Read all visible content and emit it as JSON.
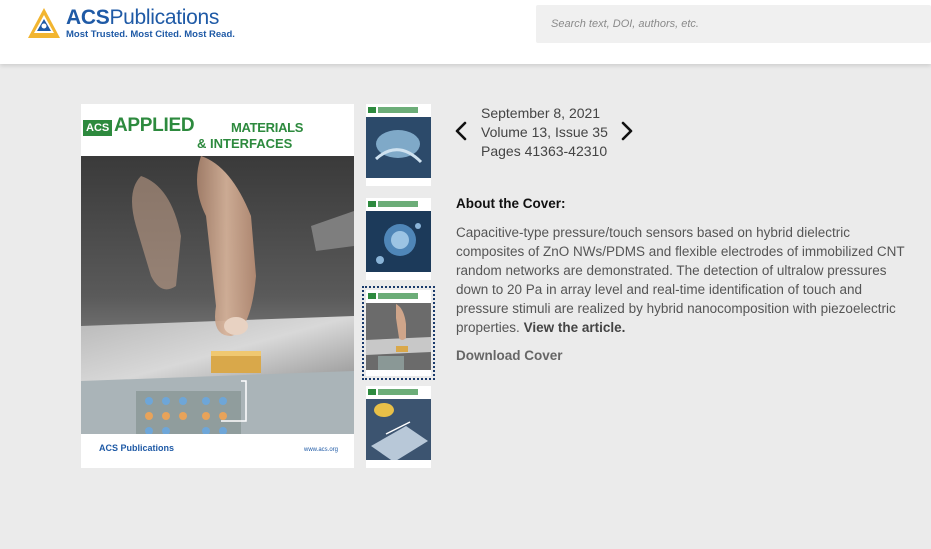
{
  "header": {
    "logo_name_bold": "ACS",
    "logo_name_rest": "Publications",
    "logo_tagline": "Most Trusted. Most Cited. Most Read.",
    "search_placeholder": "Search text, DOI, authors, etc."
  },
  "cover": {
    "badge": "ACS",
    "title_line1": "APPLIED",
    "title_line1b": "MATERIALS",
    "title_line2": "& INTERFACES",
    "footer_logo": "ACS Publications",
    "footer_url": "www.acs.org"
  },
  "issue": {
    "date": "September 8, 2021",
    "volume": "Volume 13, Issue 35",
    "pages": "Pages 41363-42310",
    "prev_icon": "chevron-left-icon",
    "next_icon": "chevron-right-icon"
  },
  "about": {
    "title": "About the Cover:",
    "text": "Capacitive-type pressure/touch sensors based on hybrid dielectric composites of ZnO NWs/PDMS and flexible electrodes of immobilized CNT random networks are demonstrated. The detection of ultralow pressures down to 20 Pa in array level and real-time identification of touch and pressure stimuli are realized by hybrid nanocomposition with piezoelectric properties.",
    "link": "View the article.",
    "download": "Download Cover"
  },
  "thumbnails": [
    {
      "name": "thumb-cover-1",
      "selected": false
    },
    {
      "name": "thumb-cover-2",
      "selected": false
    },
    {
      "name": "thumb-cover-3",
      "selected": true
    },
    {
      "name": "thumb-cover-4",
      "selected": false
    }
  ],
  "colors": {
    "brand_blue": "#1f5aa6",
    "journal_green": "#2d8a3e",
    "selection_border": "#1a3a6b"
  }
}
